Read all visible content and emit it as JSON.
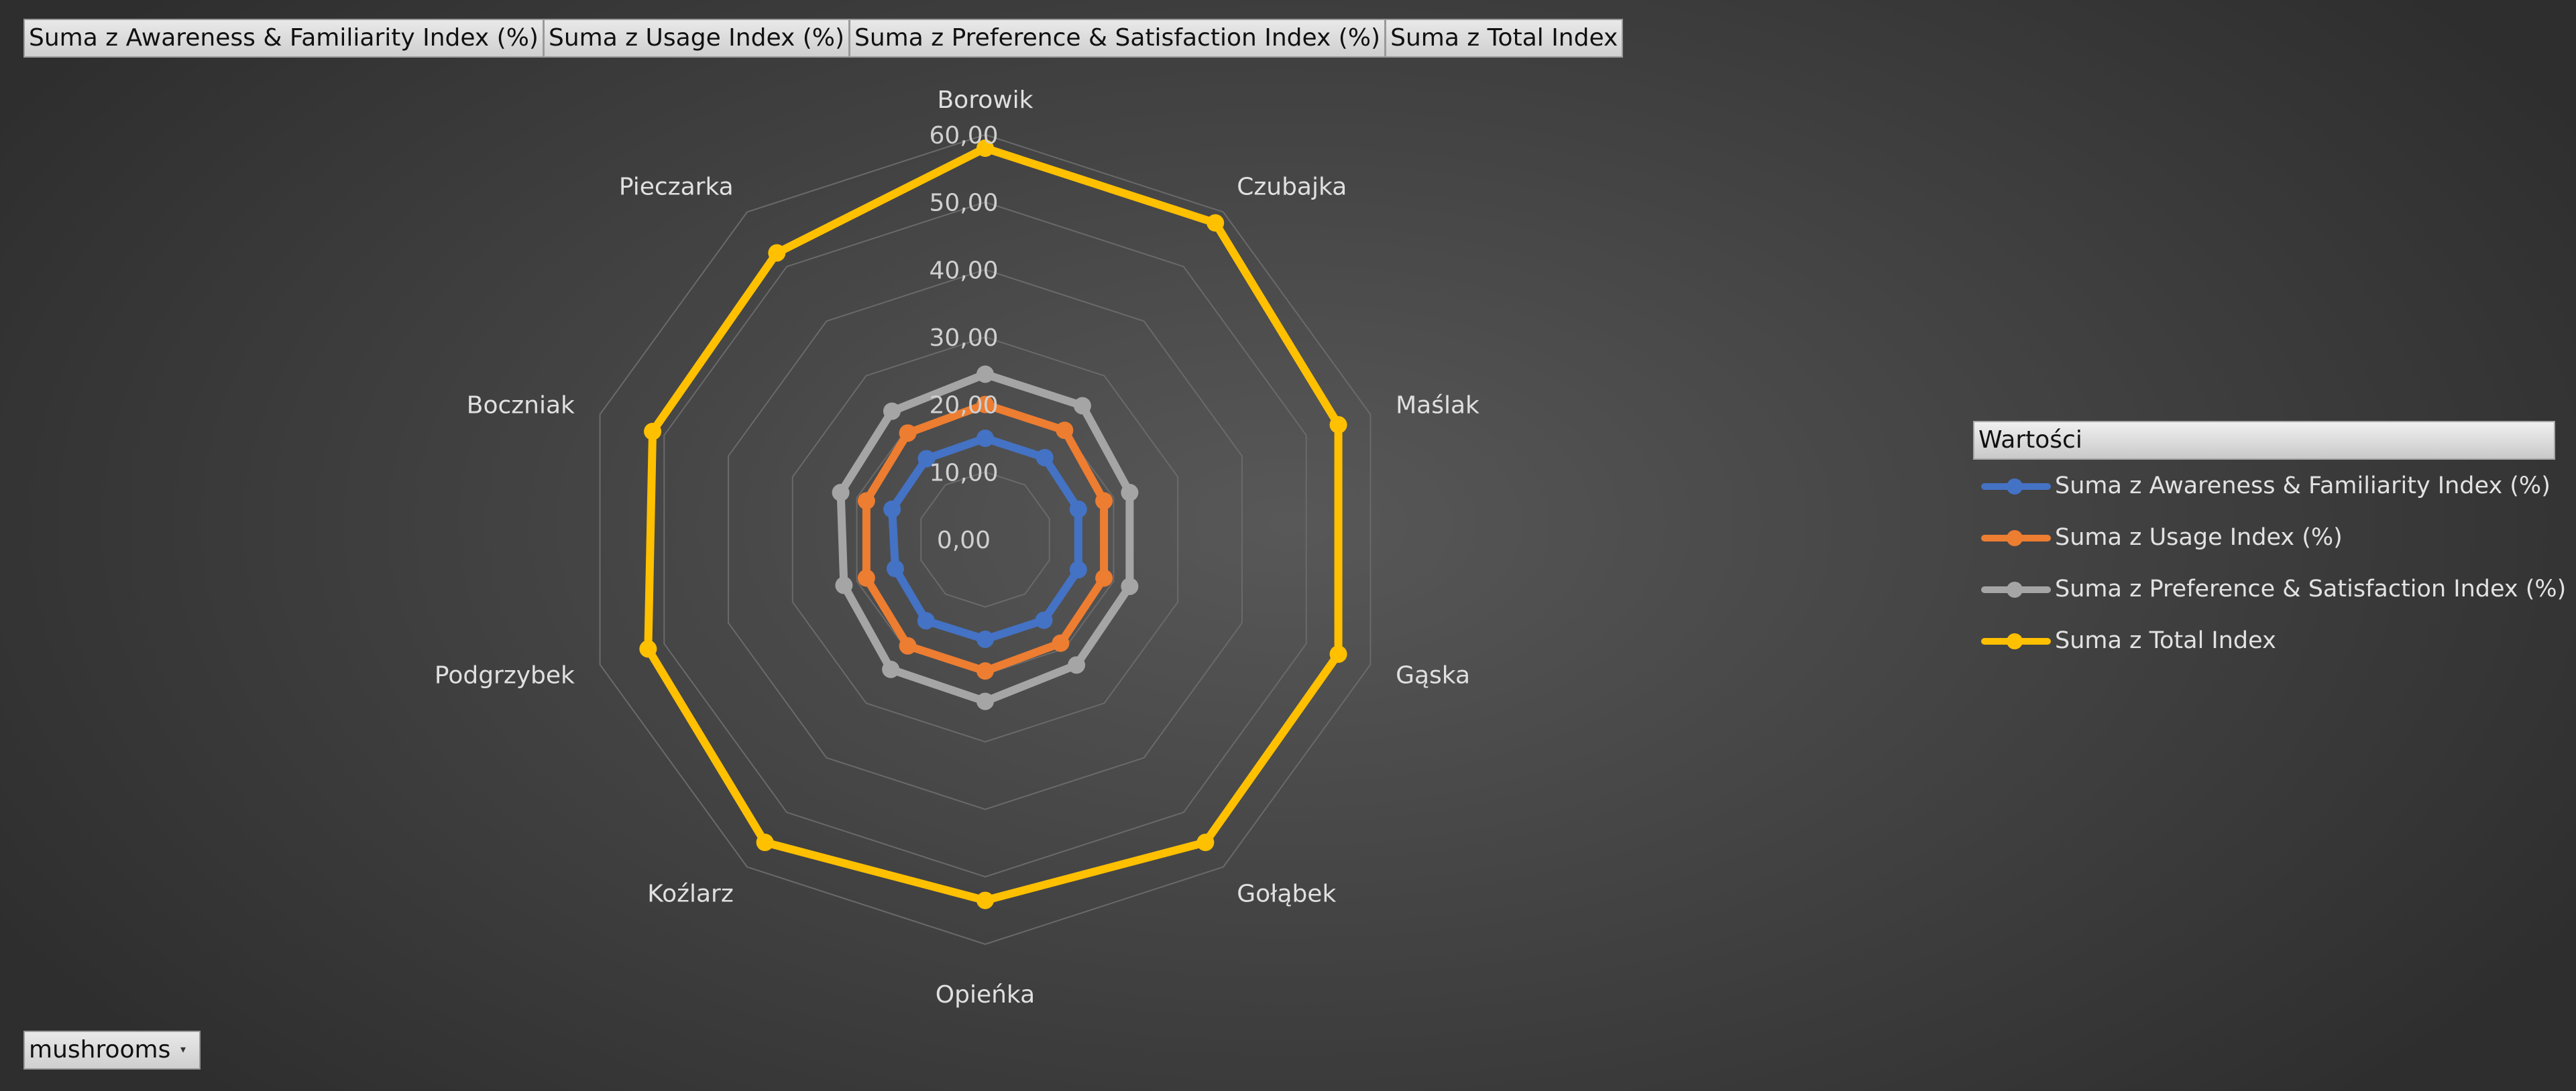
{
  "field_buttons": [
    "Suma z Awareness & Familiarity  Index (%)",
    "Suma z Usage Index (%)",
    "Suma z  Preference & Satisfaction Index (%)",
    "Suma z Total Index"
  ],
  "filter": {
    "label": "mushrooms",
    "arrow": "▾"
  },
  "legend": {
    "title": "Wartości"
  },
  "chart_data": {
    "type": "radar",
    "categories": [
      "Borowik",
      "Czubajka",
      "Maślak",
      "Gąska",
      "Gołąbek",
      "Opieńka",
      "Koźlarz",
      "Podgrzybek",
      "Boczniak",
      "Pieczarka"
    ],
    "rlim": [
      0,
      60
    ],
    "ticks": [
      "0,00",
      "10,00",
      "20,00",
      "30,00",
      "40,00",
      "50,00",
      "60,00"
    ],
    "grid": true,
    "legend_position": "right",
    "series": [
      {
        "name": "Suma z Awareness & Familiarity Index (%)",
        "color": "#4472C4",
        "values": [
          15.0,
          15.0,
          14.5,
          14.5,
          14.8,
          14.8,
          14.9,
          14.0,
          14.5,
          14.8
        ]
      },
      {
        "name": "Suma z Usage Index (%)",
        "color": "#ED7D31",
        "values": [
          20.0,
          20.0,
          18.5,
          18.5,
          19.0,
          19.5,
          19.5,
          18.5,
          18.5,
          19.5
        ]
      },
      {
        "name": "Suma z  Preference & Satisfaction Index (%)",
        "color": "#A5A5A5",
        "values": [
          24.5,
          24.5,
          22.5,
          22.5,
          23.0,
          24.0,
          23.8,
          22.0,
          22.5,
          23.5
        ]
      },
      {
        "name": "Suma z Total Index",
        "color": "#FFC000",
        "values": [
          58.0,
          58.0,
          55.0,
          55.0,
          55.5,
          53.5,
          55.5,
          52.5,
          51.8,
          52.5
        ]
      }
    ]
  }
}
